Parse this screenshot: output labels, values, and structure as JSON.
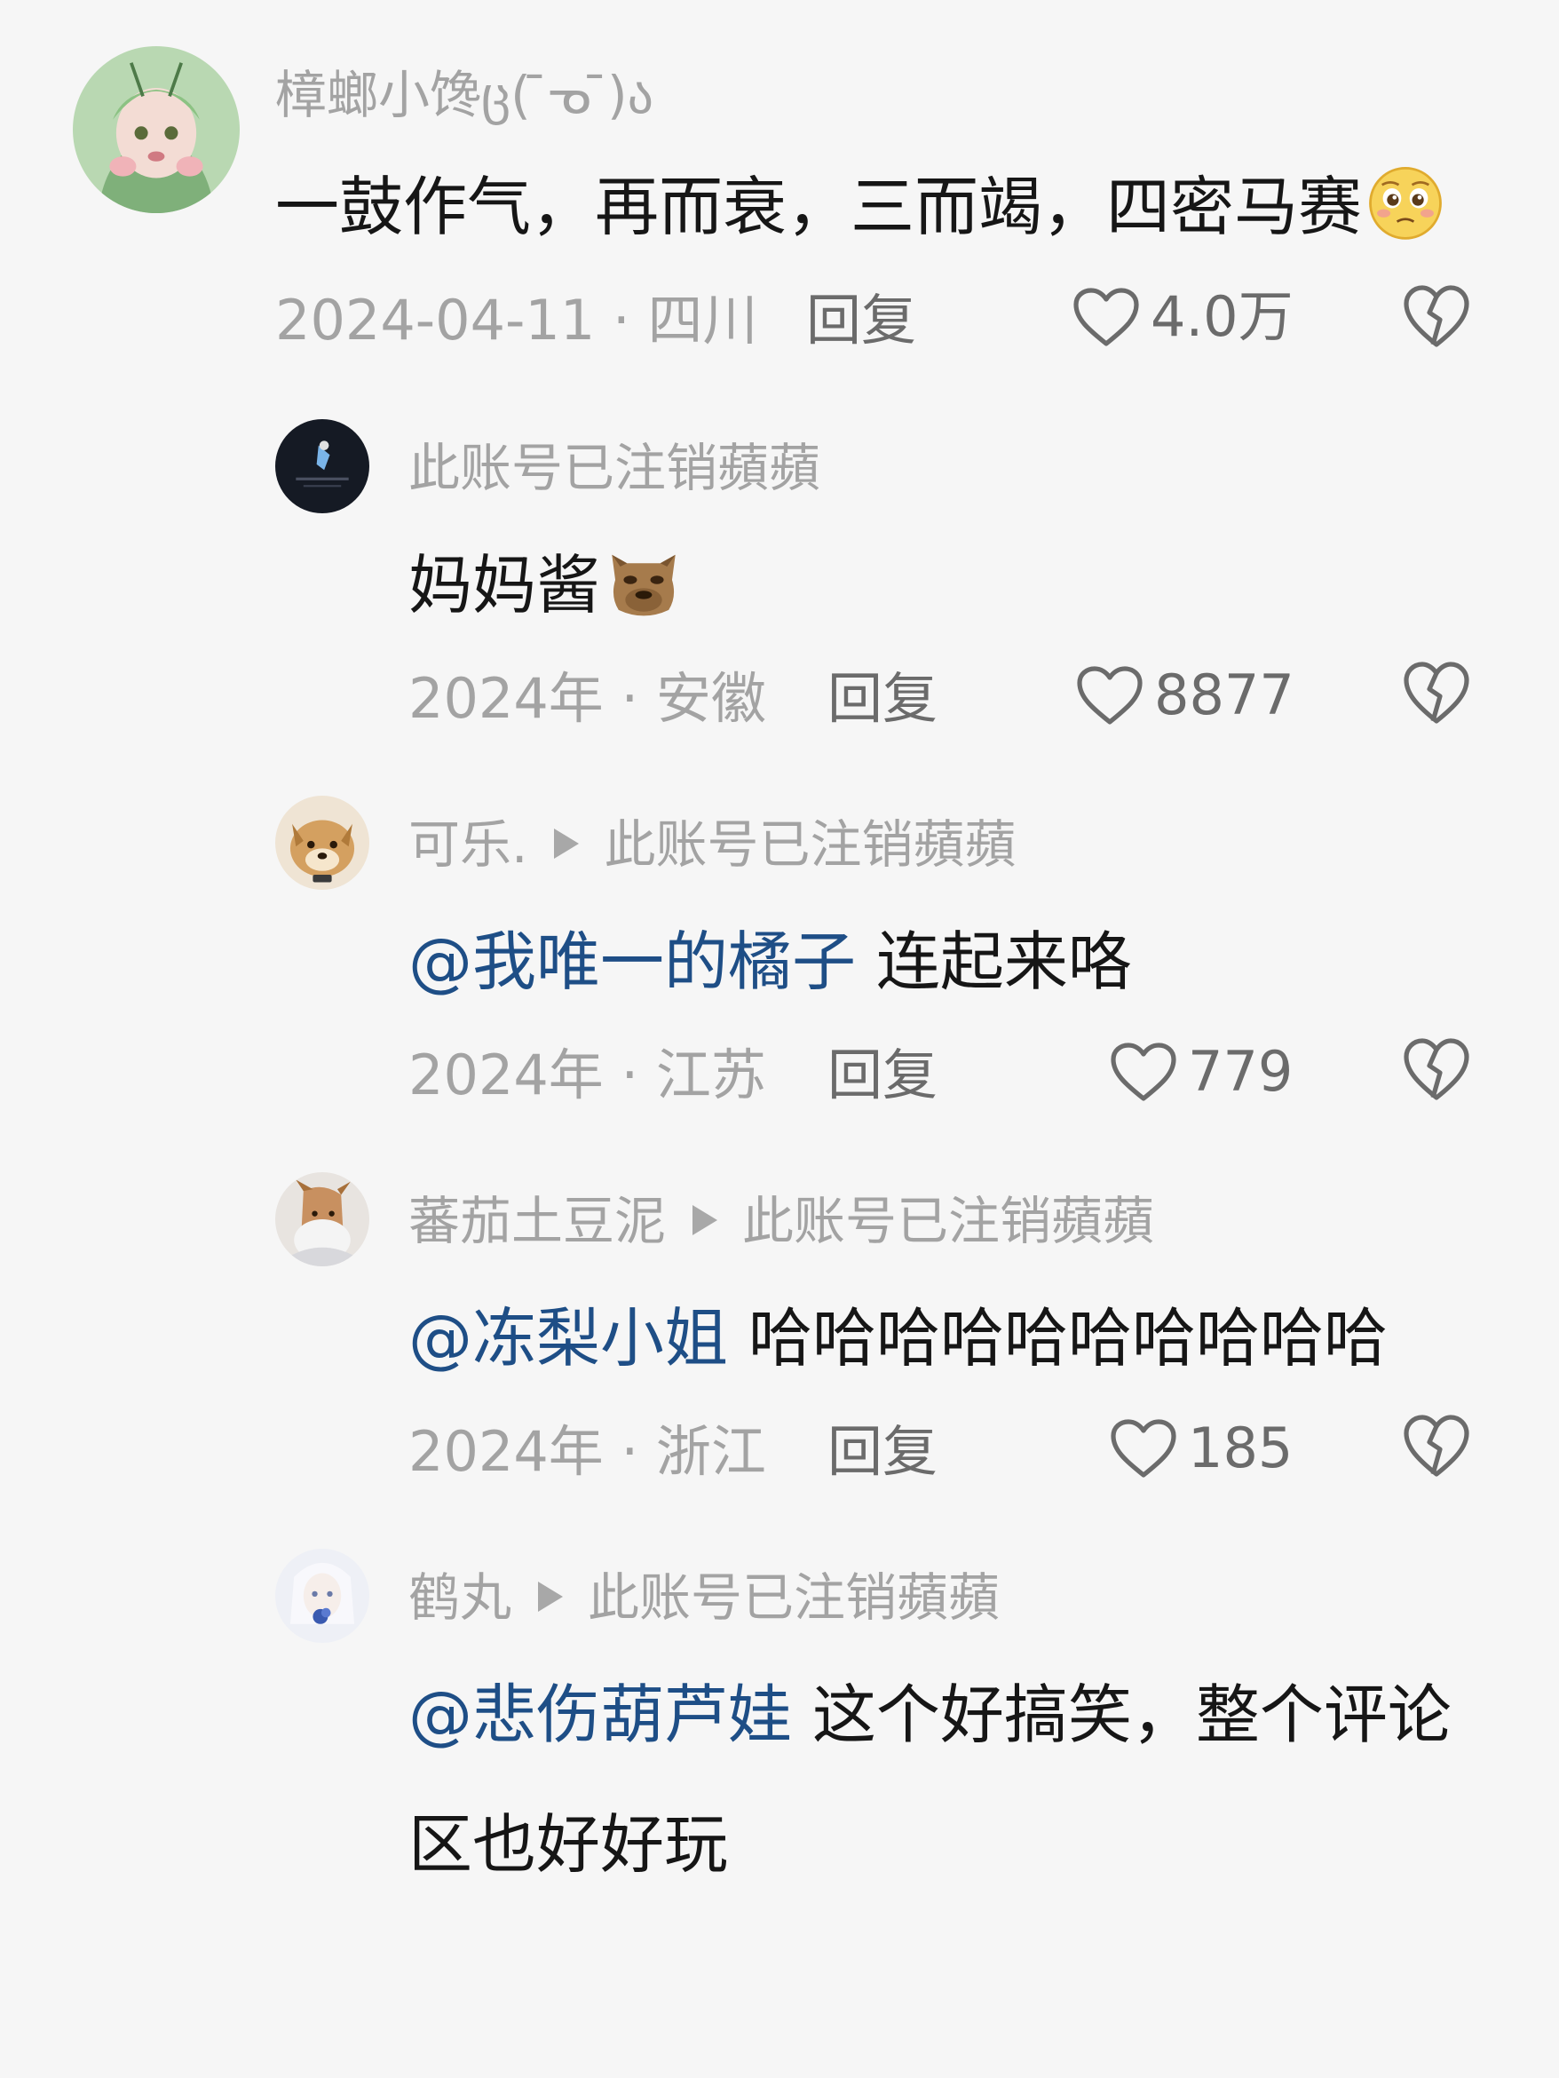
{
  "comments": [
    {
      "username": "樟螂小馋ც( ̄ᓀ ̄)ა",
      "text": "一鼓作气，再而衰，三而竭，四密马赛",
      "emoji": "pleading-face-emoji",
      "date_region": "2024-04-11 · 四川",
      "reply_label": "回复",
      "likes": "4.0万"
    },
    {
      "username": "此账号已注销蘋蘋",
      "text": "妈妈酱",
      "emoji": "capybara-emoji",
      "date_region": "2024年 · 安徽",
      "reply_label": "回复",
      "likes": "8877"
    },
    {
      "username": "可乐.",
      "reply_to": "此账号已注销蘋蘋",
      "mention": "@我唯一的橘子",
      "text": "连起来咯",
      "date_region": "2024年 · 江苏",
      "reply_label": "回复",
      "likes": "779"
    },
    {
      "username": "蕃茄土豆泥",
      "reply_to": "此账号已注销蘋蘋",
      "mention": "@冻梨小姐",
      "text": "哈哈哈哈哈哈哈哈哈哈",
      "date_region": "2024年 · 浙江",
      "reply_label": "回复",
      "likes": "185"
    },
    {
      "username": "鹤丸",
      "reply_to": "此账号已注销蘋蘋",
      "mention": "@悲伤葫芦娃",
      "text_line1": "这个好搞笑，整个评论",
      "text_line2": "区也好好玩"
    }
  ],
  "icons": {
    "like": "heart-outline-icon",
    "dislike": "broken-heart-icon",
    "reply_indicator": "play-triangle-icon"
  },
  "colors": {
    "mention": "#1e4e86",
    "secondary_text": "#a3a3a3",
    "background": "#f6f6f6"
  }
}
